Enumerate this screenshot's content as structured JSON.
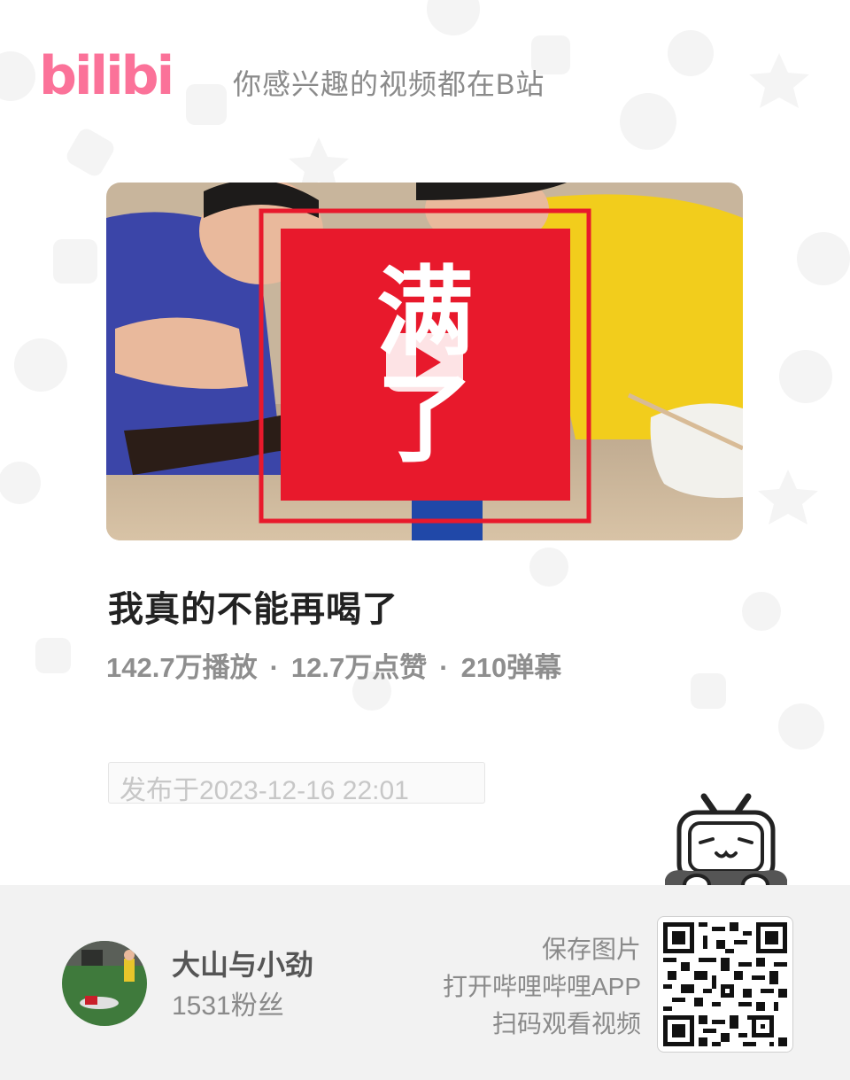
{
  "header": {
    "logo_text": "bilibili",
    "slogan": "你感兴趣的视频都在B站"
  },
  "video": {
    "overlay_text": "满了",
    "title": "我真的不能再喝了",
    "plays": "142.7万播放",
    "likes": "12.7万点赞",
    "danmaku": "210弹幕",
    "separator": "·",
    "published": "发布于2023-12-16 22:01"
  },
  "uploader": {
    "name": "大山与小劲",
    "fans": "1531粉丝"
  },
  "qr": {
    "line1": "保存图片",
    "line2": "打开哔哩哔哩APP",
    "line3": "扫码观看视频"
  },
  "colors": {
    "brand_pink": "#fb7299",
    "stamp_red": "#e8192c"
  },
  "icons": {
    "play": "play-icon",
    "mascot": "bilibili-tv-mascot"
  }
}
